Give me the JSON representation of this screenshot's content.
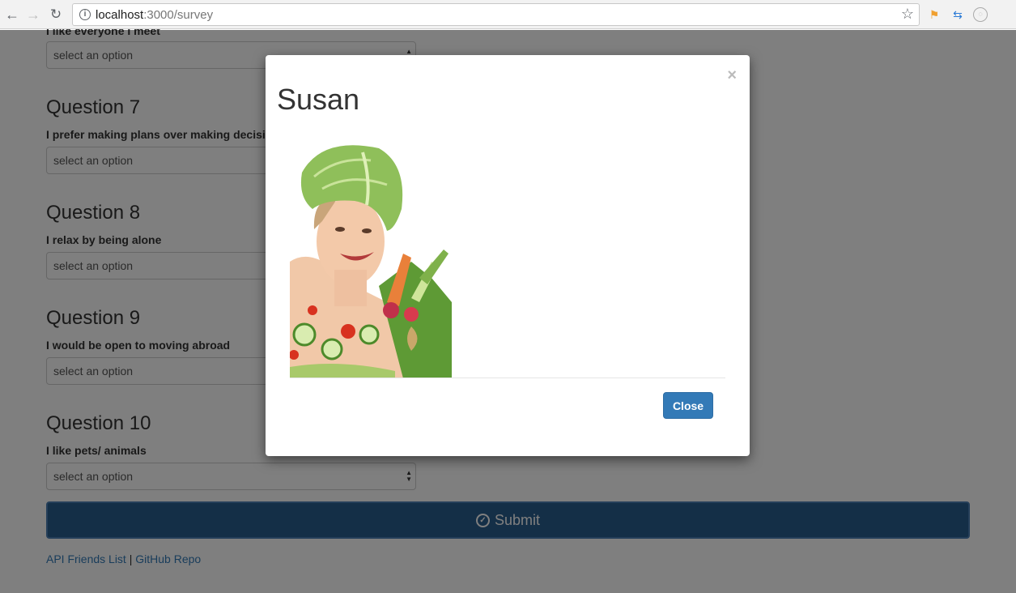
{
  "browser": {
    "url_host": "localhost",
    "url_path": ":3000/survey"
  },
  "survey": {
    "partial_question_text": "I like everyone I meet",
    "select_placeholder": "select an option",
    "questions": [
      {
        "title": "Question 7",
        "text": "I prefer making plans over making decisi"
      },
      {
        "title": "Question 8",
        "text": "I relax by being alone"
      },
      {
        "title": "Question 9",
        "text": "I would be open to moving abroad"
      },
      {
        "title": "Question 10",
        "text": "I like pets/ animals"
      }
    ],
    "submit_label": "Submit"
  },
  "footer": {
    "link1": "API Friends List",
    "separator": "|",
    "link2": "GitHub Repo"
  },
  "modal": {
    "title": "Susan",
    "close_x": "×",
    "close_label": "Close"
  }
}
